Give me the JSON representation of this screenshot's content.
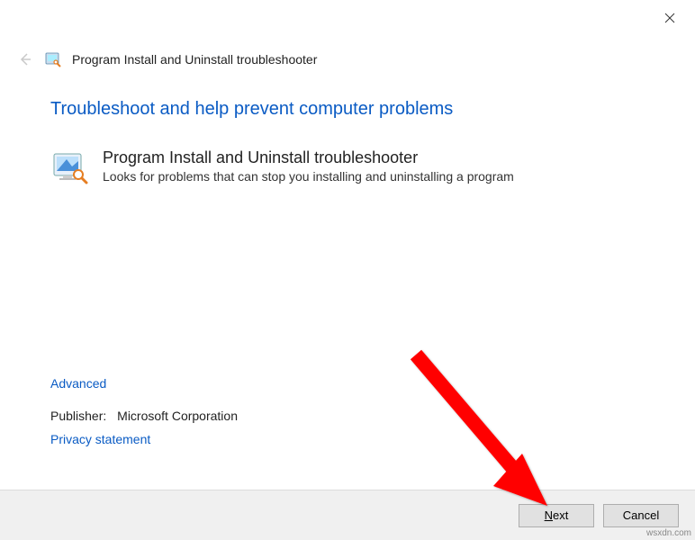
{
  "window": {
    "title": "Program Install and Uninstall troubleshooter"
  },
  "heading": "Troubleshoot and help prevent computer problems",
  "troubleshooter": {
    "title": "Program Install and Uninstall troubleshooter",
    "description": "Looks for problems that can stop you installing and uninstalling a program"
  },
  "links": {
    "advanced": "Advanced",
    "privacy": "Privacy statement"
  },
  "publisher": {
    "label": "Publisher:",
    "value": "Microsoft Corporation"
  },
  "buttons": {
    "next": "Next",
    "cancel": "Cancel"
  },
  "watermark": "wsxdn.com"
}
